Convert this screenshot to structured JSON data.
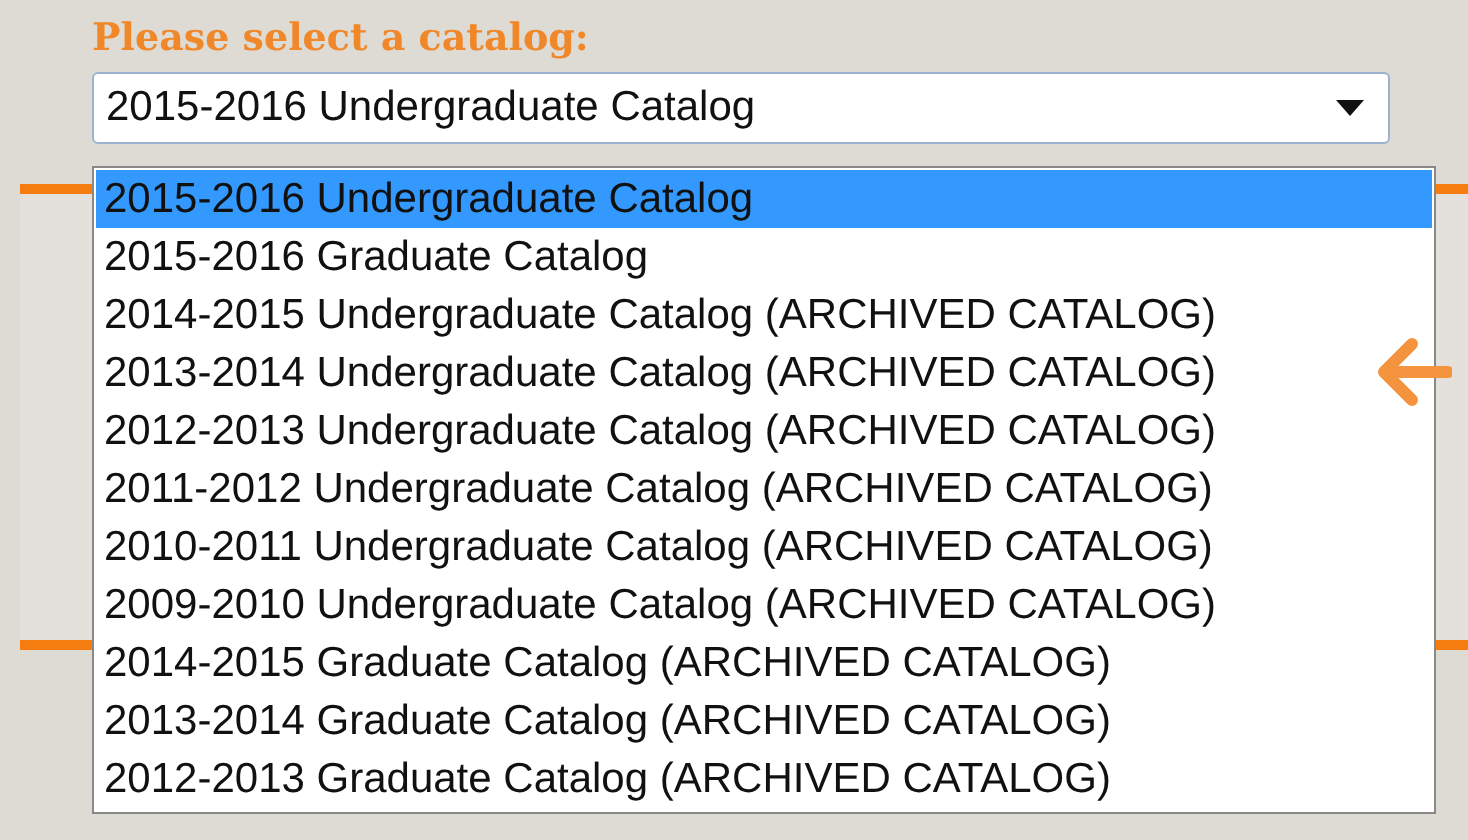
{
  "label": "Please select a catalog:",
  "select": {
    "value": "2015-2016 Undergraduate Catalog"
  },
  "options": [
    {
      "label": "2015-2016 Undergraduate Catalog",
      "selected": true
    },
    {
      "label": "2015-2016 Graduate Catalog",
      "selected": false
    },
    {
      "label": "2014-2015 Undergraduate Catalog (ARCHIVED CATALOG)",
      "selected": false
    },
    {
      "label": "2013-2014 Undergraduate Catalog (ARCHIVED CATALOG)",
      "selected": false
    },
    {
      "label": "2012-2013 Undergraduate Catalog (ARCHIVED CATALOG)",
      "selected": false
    },
    {
      "label": "2011-2012 Undergraduate Catalog (ARCHIVED CATALOG)",
      "selected": false
    },
    {
      "label": "2010-2011 Undergraduate Catalog (ARCHIVED CATALOG)",
      "selected": false
    },
    {
      "label": "2009-2010 Undergraduate Catalog (ARCHIVED CATALOG)",
      "selected": false
    },
    {
      "label": "2014-2015 Graduate Catalog (ARCHIVED CATALOG)",
      "selected": false
    },
    {
      "label": "2013-2014 Graduate Catalog (ARCHIVED CATALOG)",
      "selected": false
    },
    {
      "label": "2012-2013 Graduate Catalog (ARCHIVED CATALOG)",
      "selected": false
    }
  ]
}
